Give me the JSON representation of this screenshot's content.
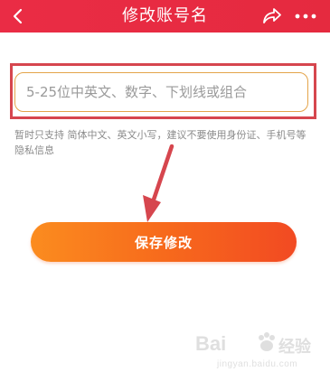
{
  "header": {
    "title": "修改账号名",
    "back_icon": "chevron-left-icon",
    "share_icon": "share-icon",
    "more_icon": "more-icon",
    "background_color": "#e52a3f"
  },
  "form": {
    "name_input": {
      "value": "",
      "placeholder": "5-25位中英文、数字、下划线或组合"
    },
    "hint": "暂时只支持 简体中文、英文小写，建议不要使用身份证、手机号等隐私信息"
  },
  "actions": {
    "save_label": "保存修改",
    "save_gradient": [
      "#fb8c1f",
      "#f24a22"
    ]
  },
  "annotation": {
    "highlight_color": "#d6464e"
  },
  "watermark": {
    "main": "Bai",
    "cn": "经验",
    "url": "jingyan.baidu.com"
  }
}
